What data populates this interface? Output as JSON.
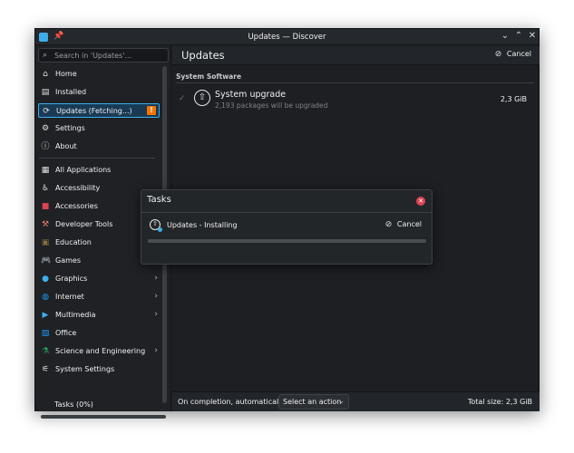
{
  "window": {
    "title": "Updates — Discover",
    "controls": [
      "chevron-down",
      "chevron-up",
      "close"
    ]
  },
  "search": {
    "placeholder": "Search in 'Updates'..."
  },
  "sidebar": {
    "top_items": [
      {
        "label": "Home",
        "icon": "home-icon"
      },
      {
        "label": "Installed",
        "icon": "installed-icon"
      },
      {
        "label": "Updates (Fetching...)",
        "icon": "updates-icon",
        "active": true,
        "badge": "!"
      },
      {
        "label": "Settings",
        "icon": "settings-icon"
      },
      {
        "label": "About",
        "icon": "info-icon"
      }
    ],
    "categories": [
      {
        "label": "All Applications",
        "icon": "grid-icon",
        "submenu": false
      },
      {
        "label": "Accessibility",
        "icon": "accessibility-icon",
        "submenu": false
      },
      {
        "label": "Accessories",
        "icon": "toolbox-icon",
        "submenu": false
      },
      {
        "label": "Developer Tools",
        "icon": "hammer-icon",
        "submenu": false
      },
      {
        "label": "Education",
        "icon": "chalkboard-icon",
        "submenu": false
      },
      {
        "label": "Games",
        "icon": "gamepad-icon",
        "submenu": false
      },
      {
        "label": "Graphics",
        "icon": "graphics-icon",
        "submenu": true
      },
      {
        "label": "Internet",
        "icon": "globe-icon",
        "submenu": true
      },
      {
        "label": "Multimedia",
        "icon": "multimedia-icon",
        "submenu": true
      },
      {
        "label": "Office",
        "icon": "office-icon",
        "submenu": false
      },
      {
        "label": "Science and Engineering",
        "icon": "flask-icon",
        "submenu": true
      },
      {
        "label": "System Settings",
        "icon": "system-settings-icon",
        "submenu": false
      }
    ],
    "tasks_label": "Tasks (0%)"
  },
  "main": {
    "title": "Updates",
    "cancel_label": "Cancel",
    "section_title": "System Software",
    "update": {
      "title": "System upgrade",
      "subtitle": "2,193 packages will be upgraded",
      "size": "2,3 GiB"
    },
    "footer": {
      "completion_label": "On completion, automatically:",
      "select_value": "Select an action",
      "total_size": "Total size: 2,3 GiB"
    }
  },
  "tasks_dialog": {
    "title": "Tasks",
    "task_label": "Updates - Installing",
    "cancel_label": "Cancel",
    "progress_fraction": 0.0
  },
  "colors": {
    "accent": "#3daee9",
    "warning": "#f67400",
    "close_red": "#da4453",
    "window_bg": "#1d1f23"
  }
}
